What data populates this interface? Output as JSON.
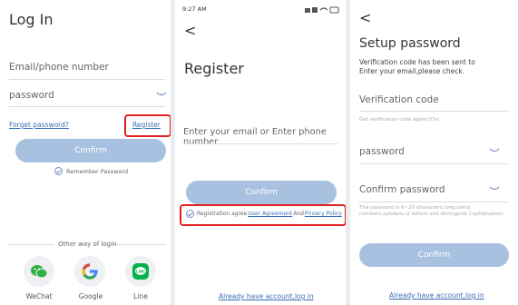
{
  "login": {
    "title": "Log In",
    "email_placeholder": "Email/phone number",
    "password_placeholder": "password",
    "forget_link": "Forget password?",
    "register_link": "Register",
    "confirm_label": "Confirm",
    "remember_label": "Remember Password",
    "other_login": "Other way of login",
    "socials": [
      {
        "label": "WeChat",
        "icon": "wechat-icon",
        "color": "#2fb040"
      },
      {
        "label": "Google",
        "icon": "google-icon",
        "color": "#4285f4"
      },
      {
        "label": "Line",
        "icon": "line-icon",
        "color": "#06b14a"
      }
    ]
  },
  "register": {
    "status_time": "9:27 AM",
    "back": "<",
    "title": "Register",
    "input_placeholder": "Enter your email or Enter phone number",
    "confirm_label": "Confirm",
    "agree_prefix": "Registration agree",
    "user_agreement": "User Agreement",
    "and_text": "And",
    "privacy_policy": "Privacy Policy",
    "already": "Already have account,log in"
  },
  "setup": {
    "back": "<",
    "title": "Setup password",
    "info_line1": "Verification code has been sent to",
    "info_line2": "Enter your email,please check.",
    "code_placeholder": "Verification code",
    "resend": "Get verification code again(37s)",
    "password_placeholder": "password",
    "confirm_placeholder": "Confirm password",
    "hint": "The password is 6~20 characters long,using numbers,symbols or letters and distinguish Capitalization",
    "confirm_label": "Confirm",
    "already": "Already have account,log in"
  },
  "colors": {
    "accent": "#a9c1e0",
    "link": "#3b6db3",
    "highlight": "#e02020"
  }
}
